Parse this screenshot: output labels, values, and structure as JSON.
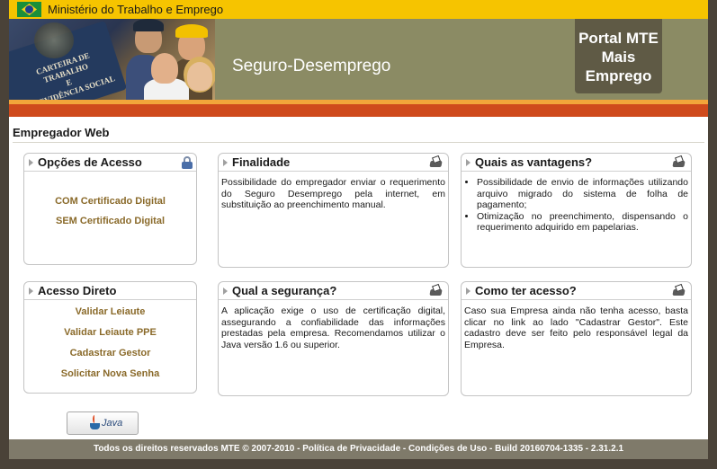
{
  "header": {
    "ministry": "Ministério do Trabalho e Emprego",
    "banner_title": "Seguro-Desemprego",
    "portal_line1": "Portal MTE",
    "portal_line2": "Mais",
    "portal_line3": "Emprego",
    "card_text_1": "CARTEIRA DE TRABALHO",
    "card_text_2": "E",
    "card_text_3": "PREVIDÊNCIA SOCIAL"
  },
  "page": {
    "section_title": "Empregador Web"
  },
  "panels": {
    "opcoes": {
      "title": "Opções de Acesso",
      "links": [
        "COM Certificado Digital",
        "SEM Certificado Digital"
      ]
    },
    "finalidade": {
      "title": "Finalidade",
      "text": "Possibilidade do empregador enviar o requerimento do Seguro Desemprego pela internet, em substituição ao preenchimento manual."
    },
    "vantagens": {
      "title": "Quais as vantagens?",
      "items": [
        "Possibilidade de envio de informações utilizando arquivo migrado do sistema de folha de pagamento;",
        "Otimização no preenchimento, dispensando o requerimento adquirido em papelarias."
      ]
    },
    "acesso_direto": {
      "title": "Acesso Direto",
      "links": [
        "Validar Leiaute",
        "Validar Leiaute PPE",
        "Cadastrar Gestor",
        "Solicitar Nova Senha"
      ]
    },
    "seguranca": {
      "title": "Qual a segurança?",
      "text": "A aplicação exige o uso de certificação digital, assegurando a confiabilidade das informações prestadas pela empresa. Recomendamos utilizar o Java versão 1.6 ou superior."
    },
    "como_acesso": {
      "title": "Como ter acesso?",
      "text": "Caso sua Empresa ainda não tenha acesso, basta clicar no link ao lado \"Cadastrar Gestor\". Este cadastro deve ser feito pelo responsável legal da Empresa."
    }
  },
  "java_button": {
    "label": "Java"
  },
  "footer": {
    "text": "Todos os direitos reservados MTE © 2007-2010 - Política de Privacidade - Condições de Uso - Build 20160704-1335 - 2.31.2.1"
  },
  "colors": {
    "topbar": "#f6c400",
    "banner": "#8b8b64",
    "portal_box": "#5f5a45",
    "stripe_red": "#cf4a1c",
    "link": "#8a6a2a",
    "footer": "#7f7a6a"
  }
}
